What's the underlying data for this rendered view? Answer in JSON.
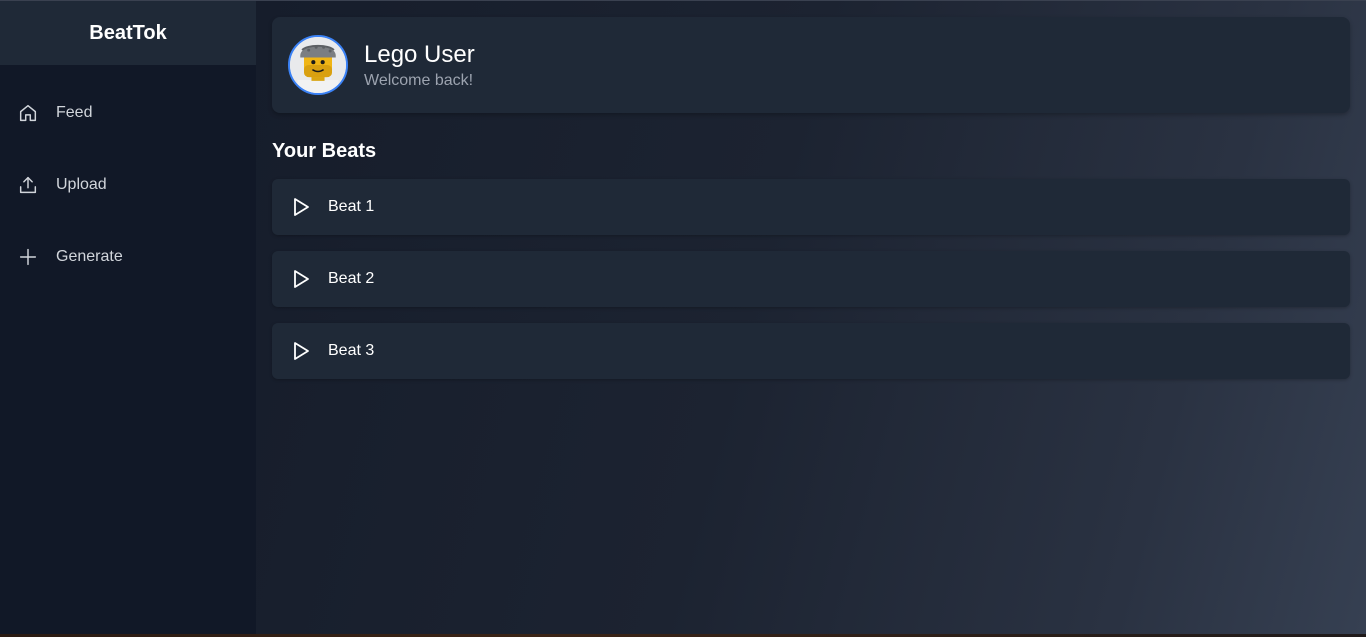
{
  "app": {
    "brand": "BeatTok"
  },
  "sidebar": {
    "items": [
      {
        "label": "Feed",
        "icon": "home-icon"
      },
      {
        "label": "Upload",
        "icon": "upload-icon"
      },
      {
        "label": "Generate",
        "icon": "plus-icon"
      }
    ]
  },
  "profile": {
    "name": "Lego User",
    "subtitle": "Welcome back!",
    "avatar": "lego-minifigure-avatar"
  },
  "beats": {
    "title": "Your Beats",
    "items": [
      {
        "label": "Beat 1",
        "icon": "play-icon"
      },
      {
        "label": "Beat 2",
        "icon": "play-icon"
      },
      {
        "label": "Beat 3",
        "icon": "play-icon"
      }
    ]
  },
  "colors": {
    "sidebar_bg": "#111827",
    "card_bg": "#1f2937",
    "accent": "#3b82f6",
    "muted_text": "#9ca3af"
  }
}
